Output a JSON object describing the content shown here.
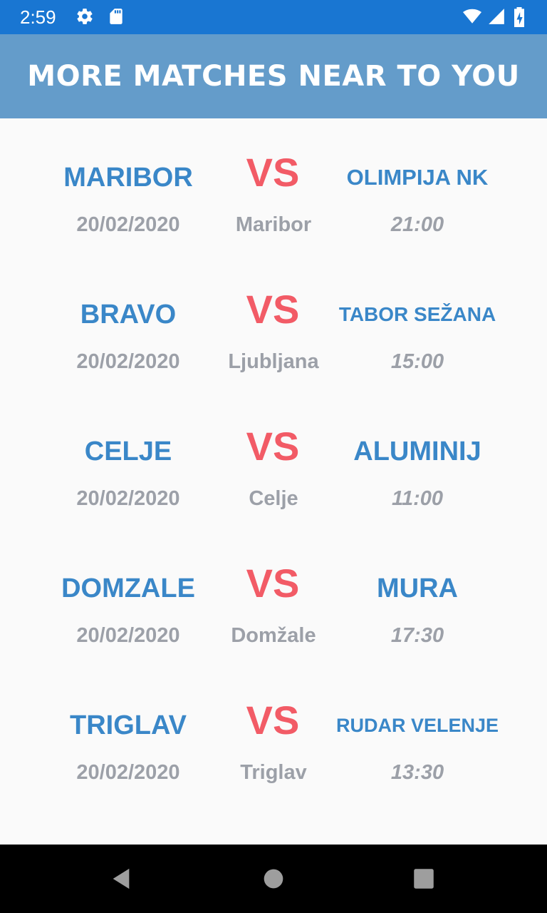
{
  "status_bar": {
    "time": "2:59",
    "icons": [
      "settings-icon",
      "sd-card-icon",
      "wifi-icon",
      "signal-icon",
      "battery-icon"
    ]
  },
  "header": {
    "title": "MORE MATCHES NEAR TO YOU"
  },
  "vs_label": "VS",
  "colors": {
    "status_bar": "#1976d2",
    "header": "#649cca",
    "team": "#3a87c8",
    "vs": "#f25b66",
    "meta": "#9ca0a8"
  },
  "matches": [
    {
      "home": "MARIBOR",
      "away": "OLIMPIJA NK",
      "date": "20/02/2020",
      "city": "Maribor",
      "time": "21:00"
    },
    {
      "home": "BRAVO",
      "away": "TABOR SEŽANA",
      "date": "20/02/2020",
      "city": "Ljubljana",
      "time": "15:00"
    },
    {
      "home": "CELJE",
      "away": "ALUMINIJ",
      "date": "20/02/2020",
      "city": "Celje",
      "time": "11:00"
    },
    {
      "home": "DOMZALE",
      "away": "MURA",
      "date": "20/02/2020",
      "city": "Domžale",
      "time": "17:30"
    },
    {
      "home": "TRIGLAV",
      "away": "RUDAR VELENJE",
      "date": "20/02/2020",
      "city": "Triglav",
      "time": "13:30"
    }
  ],
  "nav_bar": {
    "buttons": [
      "back-icon",
      "home-icon",
      "recents-icon"
    ]
  }
}
